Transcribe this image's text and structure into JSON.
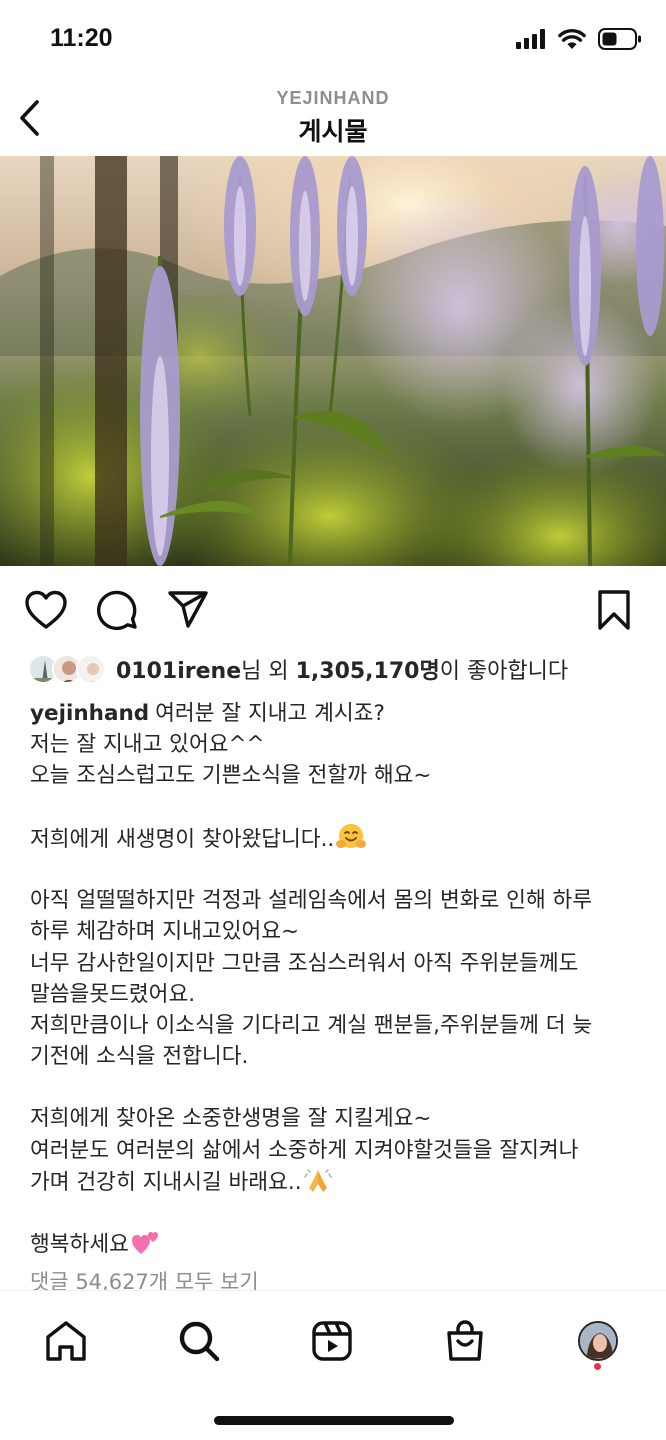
{
  "status_bar": {
    "time": "11:20",
    "icons": [
      "cellular-signal-icon",
      "wifi-icon",
      "battery-icon"
    ]
  },
  "header": {
    "account": "YEJINHAND",
    "title": "게시물",
    "back_icon": "chevron-left-icon"
  },
  "post": {
    "image_description_icon": "flowers-photo",
    "actions": {
      "like_icon": "heart-icon",
      "comment_icon": "comment-icon",
      "share_icon": "paper-plane-icon",
      "save_icon": "bookmark-icon"
    },
    "likes": {
      "first_user": "0101irene",
      "mid_text": "님 외 ",
      "count": "1,305,170명",
      "suffix": "이 좋아합니다"
    },
    "caption": {
      "username": "yejinhand",
      "lines": [
        "여러분 잘 지내고 계시죠?",
        "저는 잘 지내고 있어요^^",
        "오늘 조심스럽고도 기쁜소식을 전할까 해요~",
        "",
        "저희에게 새생명이 찾아왔답니다..",
        "",
        "아직 얼떨떨하지만 걱정과 설레임속에서 몸의 변화로 인해 하루",
        "하루 체감하며 지내고있어요~",
        "너무 감사한일이지만 그만큼 조심스러워서 아직 주위분들께도",
        "말씀을못드렸어요.",
        "저희만큼이나 이소식을 기다리고 계실 팬분들,주위분들께 더 늦",
        "기전에 소식을 전합니다.",
        "",
        "저희에게 찾아온 소중한생명을 잘 지킬게요~",
        "여러분도 여러분의 삶에서 소중하게 지켜야할것들을 잘지켜나",
        "가며 건강히 지내시길 바래요..",
        "",
        "행복하세요"
      ],
      "emojis": [
        "hugging-face-emoji",
        "folded-hands-emoji",
        "two-hearts-emoji"
      ]
    },
    "view_comments": "댓글 54,627개 모두 보기"
  },
  "tabbar": {
    "items": [
      "home-icon",
      "search-icon",
      "reels-icon",
      "shop-icon",
      "profile-avatar"
    ],
    "notification_dot_color": "#ed2e4c"
  }
}
